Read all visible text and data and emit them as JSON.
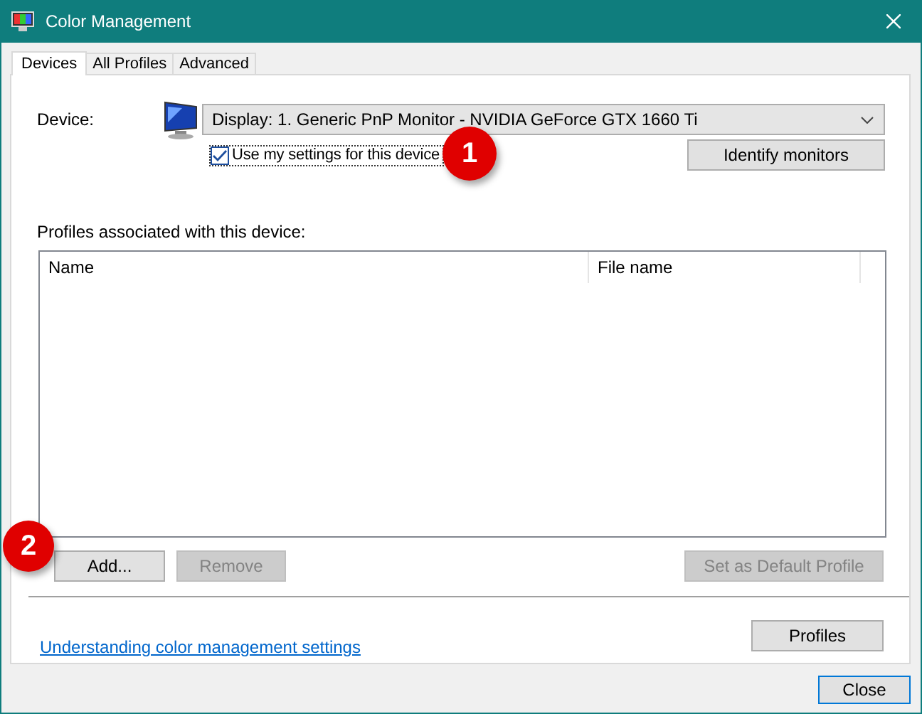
{
  "window": {
    "title": "Color Management"
  },
  "tabs": [
    {
      "label": "Devices",
      "selected": true
    },
    {
      "label": "All Profiles",
      "selected": false
    },
    {
      "label": "Advanced",
      "selected": false
    }
  ],
  "device": {
    "label": "Device:",
    "value": "Display: 1. Generic PnP Monitor - NVIDIA GeForce GTX 1660 Ti"
  },
  "use_my_settings": {
    "label": "Use my settings for this device",
    "checked": true
  },
  "identify_button": {
    "label": "Identify monitors",
    "disabled": false
  },
  "profiles_label": "Profiles associated with this device:",
  "profiles_table": {
    "columns": [
      "Name",
      "File name"
    ]
  },
  "list_buttons": [
    {
      "label": "Add...",
      "disabled": false
    },
    {
      "label": "Remove",
      "disabled": true
    }
  ],
  "default_button": {
    "label": "Set as Default Profile",
    "disabled": true
  },
  "link": "Understanding color management settings",
  "profiles_button": {
    "label": "Profiles",
    "disabled": false
  },
  "close_button": {
    "label": "Close",
    "disabled": false
  },
  "callouts": [
    "1",
    "2"
  ]
}
